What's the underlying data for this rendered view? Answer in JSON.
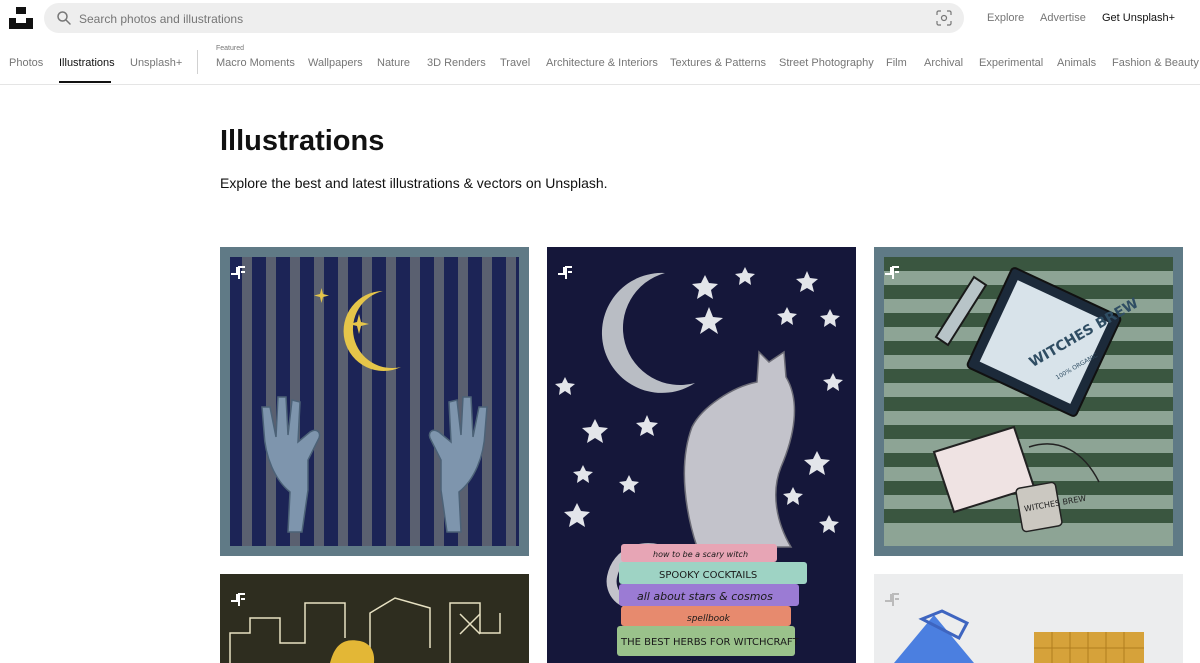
{
  "header": {
    "search_placeholder": "Search photos and illustrations",
    "links": {
      "explore": "Explore",
      "advertise": "Advertise",
      "get_plus": "Get Unsplash+"
    }
  },
  "nav": {
    "photos": "Photos",
    "illustrations": "Illustrations",
    "unsplash_plus": "Unsplash+",
    "featured_label": "Featured",
    "topics": [
      "Macro Moments",
      "Wallpapers",
      "Nature",
      "3D Renders",
      "Travel",
      "Architecture & Interiors",
      "Textures & Patterns",
      "Street Photography",
      "Film",
      "Archival",
      "Experimental",
      "Animals",
      "Fashion & Beauty"
    ]
  },
  "hero": {
    "title": "Illustrations",
    "subtitle": "Explore the best and latest illustrations & vectors on Unsplash."
  },
  "illustrations": {
    "cat": {
      "books": [
        "how to be a scary witch",
        "SPOOKY COCKTAILS",
        "all about stars & cosmos",
        "spellbook",
        "THE BEST HERBS FOR WITCHCRAFT"
      ]
    },
    "tea": {
      "box_title": "WITCHES BREW",
      "box_tag": "100% ORGANIC",
      "tag_label": "WITCHES BREW"
    }
  },
  "colors": {
    "brand": "#111111",
    "active_nav": "#111111",
    "muted": "#767676"
  }
}
